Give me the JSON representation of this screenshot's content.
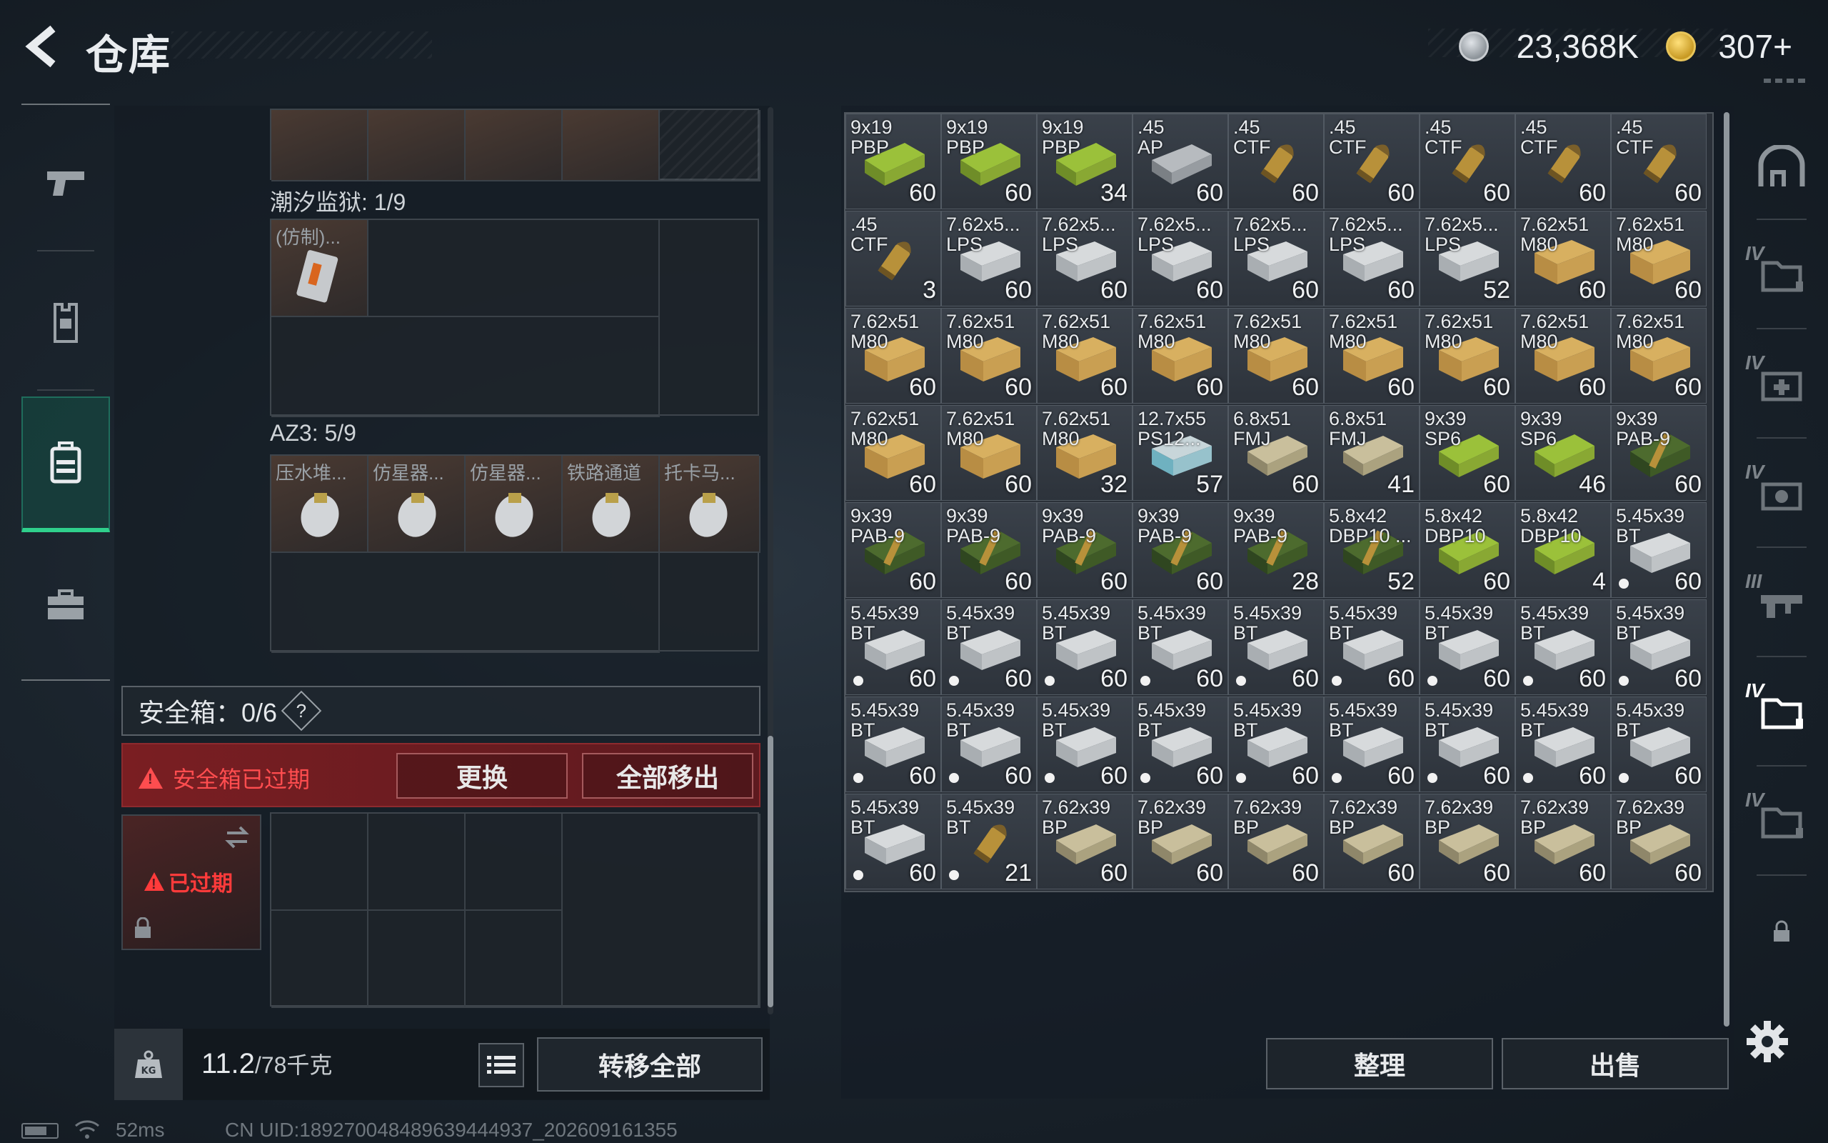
{
  "header": {
    "title": "仓库",
    "currency": [
      {
        "icon": "silver-coin-icon",
        "value": "23,368K"
      },
      {
        "icon": "gold-coin-icon",
        "value": "307+"
      }
    ]
  },
  "left_nav": {
    "items": [
      {
        "name": "weapon",
        "icon": "pistol-icon",
        "active": false
      },
      {
        "name": "armor",
        "icon": "vest-icon",
        "active": false
      },
      {
        "name": "backpack",
        "icon": "backpack-icon",
        "active": true
      },
      {
        "name": "case",
        "icon": "briefcase-icon",
        "active": false
      }
    ]
  },
  "left_panel": {
    "container_1": {
      "label": "潮汐监狱: 1/9",
      "items": [
        {
          "label": "(仿制)..."
        }
      ]
    },
    "container_2": {
      "label": "AZ3: 5/9",
      "items": [
        {
          "label": "压水堆..."
        },
        {
          "label": "仿星器..."
        },
        {
          "label": "仿星器..."
        },
        {
          "label": "铁路通道"
        },
        {
          "label": "托卡马..."
        }
      ]
    },
    "safe_box": {
      "label": "安全箱：0/6",
      "help": "?"
    },
    "expired_bar": {
      "warning": "安全箱已过期",
      "replace_label": "更换",
      "remove_all_label": "全部移出"
    },
    "safe_slot": {
      "expired_label": "已过期"
    },
    "footer": {
      "weight": "11.2",
      "weight_max": "/78千克",
      "transfer_all_label": "转移全部"
    }
  },
  "stash": {
    "colors": {
      "green_box": "#9bc13a",
      "yellow_box": "#d8b060",
      "white_box": "#d7dadc",
      "brass": "#b8913a",
      "teal": "#6fb1c0"
    },
    "rows": [
      [
        {
          "name": "9x19\nPBP",
          "count": "60",
          "art": "green-box"
        },
        {
          "name": "9x19\nPBP",
          "count": "60",
          "art": "green-box"
        },
        {
          "name": "9x19\nPBP",
          "count": "34",
          "art": "green-box"
        },
        {
          "name": ".45\nAP",
          "count": "60",
          "art": "silver-box"
        },
        {
          "name": ".45\nCTF",
          "count": "60",
          "art": "round"
        },
        {
          "name": ".45\nCTF",
          "count": "60",
          "art": "round"
        },
        {
          "name": ".45\nCTF",
          "count": "60",
          "art": "round"
        },
        {
          "name": ".45\nCTF",
          "count": "60",
          "art": "round"
        },
        {
          "name": ".45\nCTF",
          "count": "60",
          "art": "round"
        }
      ],
      [
        {
          "name": ".45\nCTF",
          "count": "3",
          "art": "round"
        },
        {
          "name": "7.62x5...\nLPS",
          "count": "60",
          "art": "white-box"
        },
        {
          "name": "7.62x5...\nLPS",
          "count": "60",
          "art": "white-box"
        },
        {
          "name": "7.62x5...\nLPS",
          "count": "60",
          "art": "white-box"
        },
        {
          "name": "7.62x5...\nLPS",
          "count": "60",
          "art": "white-box"
        },
        {
          "name": "7.62x5...\nLPS",
          "count": "60",
          "art": "white-box"
        },
        {
          "name": "7.62x5...\nLPS",
          "count": "52",
          "art": "white-box"
        },
        {
          "name": "7.62x51\nM80",
          "count": "60",
          "art": "yellow-box"
        },
        {
          "name": "7.62x51\nM80",
          "count": "60",
          "art": "yellow-box"
        }
      ],
      [
        {
          "name": "7.62x51\nM80",
          "count": "60",
          "art": "yellow-box"
        },
        {
          "name": "7.62x51\nM80",
          "count": "60",
          "art": "yellow-box"
        },
        {
          "name": "7.62x51\nM80",
          "count": "60",
          "art": "yellow-box"
        },
        {
          "name": "7.62x51\nM80",
          "count": "60",
          "art": "yellow-box"
        },
        {
          "name": "7.62x51\nM80",
          "count": "60",
          "art": "yellow-box"
        },
        {
          "name": "7.62x51\nM80",
          "count": "60",
          "art": "yellow-box"
        },
        {
          "name": "7.62x51\nM80",
          "count": "60",
          "art": "yellow-box"
        },
        {
          "name": "7.62x51\nM80",
          "count": "60",
          "art": "yellow-box"
        },
        {
          "name": "7.62x51\nM80",
          "count": "60",
          "art": "yellow-box"
        }
      ],
      [
        {
          "name": "7.62x51\nM80",
          "count": "60",
          "art": "yellow-box"
        },
        {
          "name": "7.62x51\nM80",
          "count": "60",
          "art": "yellow-box"
        },
        {
          "name": "7.62x51\nM80",
          "count": "32",
          "art": "yellow-box"
        },
        {
          "name": "12.7x55\nPS12...",
          "count": "57",
          "art": "teal-box"
        },
        {
          "name": "6.8x51\nFMJ",
          "count": "60",
          "art": "tan-box"
        },
        {
          "name": "6.8x51\nFMJ",
          "count": "41",
          "art": "tan-box"
        },
        {
          "name": "9x39\nSP6",
          "count": "60",
          "art": "green-box"
        },
        {
          "name": "9x39\nSP6",
          "count": "46",
          "art": "green-box"
        },
        {
          "name": "9x39\nPAB-9",
          "count": "60",
          "art": "dark-green-box"
        }
      ],
      [
        {
          "name": "9x39\nPAB-9",
          "count": "60",
          "art": "dark-green-box"
        },
        {
          "name": "9x39\nPAB-9",
          "count": "60",
          "art": "dark-green-box"
        },
        {
          "name": "9x39\nPAB-9",
          "count": "60",
          "art": "dark-green-box"
        },
        {
          "name": "9x39\nPAB-9",
          "count": "60",
          "art": "dark-green-box"
        },
        {
          "name": "9x39\nPAB-9",
          "count": "28",
          "art": "dark-green-box"
        },
        {
          "name": "5.8x42\nDBP10 ...",
          "count": "52",
          "art": "dark-green-box"
        },
        {
          "name": "5.8x42\nDBP10",
          "count": "60",
          "art": "green-box"
        },
        {
          "name": "5.8x42\nDBP10",
          "count": "4",
          "art": "green-box"
        },
        {
          "name": "5.45x39\nBT",
          "count": "60",
          "art": "white-box",
          "dot": true
        }
      ],
      [
        {
          "name": "5.45x39\nBT",
          "count": "60",
          "art": "white-box",
          "dot": true
        },
        {
          "name": "5.45x39\nBT",
          "count": "60",
          "art": "white-box",
          "dot": true
        },
        {
          "name": "5.45x39\nBT",
          "count": "60",
          "art": "white-box",
          "dot": true
        },
        {
          "name": "5.45x39\nBT",
          "count": "60",
          "art": "white-box",
          "dot": true
        },
        {
          "name": "5.45x39\nBT",
          "count": "60",
          "art": "white-box",
          "dot": true
        },
        {
          "name": "5.45x39\nBT",
          "count": "60",
          "art": "white-box",
          "dot": true
        },
        {
          "name": "5.45x39\nBT",
          "count": "60",
          "art": "white-box",
          "dot": true
        },
        {
          "name": "5.45x39\nBT",
          "count": "60",
          "art": "white-box",
          "dot": true
        },
        {
          "name": "5.45x39\nBT",
          "count": "60",
          "art": "white-box",
          "dot": true
        }
      ],
      [
        {
          "name": "5.45x39\nBT",
          "count": "60",
          "art": "white-box",
          "dot": true
        },
        {
          "name": "5.45x39\nBT",
          "count": "60",
          "art": "white-box",
          "dot": true
        },
        {
          "name": "5.45x39\nBT",
          "count": "60",
          "art": "white-box",
          "dot": true
        },
        {
          "name": "5.45x39\nBT",
          "count": "60",
          "art": "white-box",
          "dot": true
        },
        {
          "name": "5.45x39\nBT",
          "count": "60",
          "art": "white-box",
          "dot": true
        },
        {
          "name": "5.45x39\nBT",
          "count": "60",
          "art": "white-box",
          "dot": true
        },
        {
          "name": "5.45x39\nBT",
          "count": "60",
          "art": "white-box",
          "dot": true
        },
        {
          "name": "5.45x39\nBT",
          "count": "60",
          "art": "white-box",
          "dot": true
        },
        {
          "name": "5.45x39\nBT",
          "count": "60",
          "art": "white-box",
          "dot": true
        }
      ],
      [
        {
          "name": "5.45x39\nBT",
          "count": "60",
          "art": "white-box",
          "dot": true
        },
        {
          "name": "5.45x39\nBT",
          "count": "21",
          "art": "round",
          "dot": true
        },
        {
          "name": "7.62x39\nBP",
          "count": "60",
          "art": "tan-box"
        },
        {
          "name": "7.62x39\nBP",
          "count": "60",
          "art": "tan-box"
        },
        {
          "name": "7.62x39\nBP",
          "count": "60",
          "art": "tan-box"
        },
        {
          "name": "7.62x39\nBP",
          "count": "60",
          "art": "tan-box"
        },
        {
          "name": "7.62x39\nBP",
          "count": "60",
          "art": "tan-box"
        },
        {
          "name": "7.62x39\nBP",
          "count": "60",
          "art": "tan-box"
        },
        {
          "name": "7.62x39\nBP",
          "count": "60",
          "art": "tan-box"
        }
      ]
    ],
    "sort_label": "整理",
    "sell_label": "出售"
  },
  "right_nav": {
    "items": [
      {
        "name": "stash-home",
        "tier": "",
        "icon": "shelter-icon"
      },
      {
        "name": "tier-iv-folder",
        "tier": "IV",
        "icon": "folder-icon"
      },
      {
        "name": "tier-iv-medkit",
        "tier": "IV",
        "icon": "medkit-icon"
      },
      {
        "name": "tier-iv-camera",
        "tier": "IV",
        "icon": "camera-icon"
      },
      {
        "name": "tier-iii-gun",
        "tier": "III",
        "icon": "rifle-icon"
      },
      {
        "name": "tier-iv-folder-active",
        "tier": "IV",
        "icon": "folder-icon",
        "active": true
      },
      {
        "name": "tier-iv-folder-2",
        "tier": "IV",
        "icon": "folder-icon"
      },
      {
        "name": "lock",
        "tier": "",
        "icon": "lock-icon"
      }
    ]
  },
  "status_bar": {
    "ping": "52ms",
    "uid": "CN UID:189270048489639444937_202609161355"
  }
}
